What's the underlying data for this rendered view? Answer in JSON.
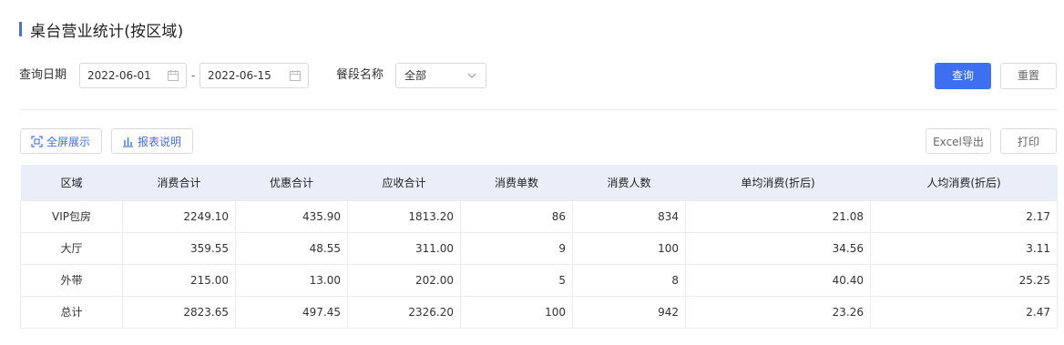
{
  "page": {
    "title": "桌台营业统计(按区域)"
  },
  "filters": {
    "date_label": "查询日期",
    "date_start": "2022-06-01",
    "date_sep": "-",
    "date_end": "2022-06-15",
    "meal_label": "餐段名称",
    "meal_value": "全部",
    "query_button": "查询",
    "reset_button": "重置"
  },
  "toolbar": {
    "fullscreen": "全屏展示",
    "report_desc": "报表说明",
    "excel_export": "Excel导出",
    "print": "打印"
  },
  "colors": {
    "accent": "#3d6ff0",
    "header_bg": "#e9eef9"
  },
  "table": {
    "columns": [
      "区域",
      "消费合计",
      "优惠合计",
      "应收合计",
      "消费单数",
      "消费人数",
      "单均消费(折后)",
      "人均消费(折后)"
    ],
    "rows": [
      [
        "VIP包房",
        "2249.10",
        "435.90",
        "1813.20",
        "86",
        "834",
        "21.08",
        "2.17"
      ],
      [
        "大厅",
        "359.55",
        "48.55",
        "311.00",
        "9",
        "100",
        "34.56",
        "3.11"
      ],
      [
        "外带",
        "215.00",
        "13.00",
        "202.00",
        "5",
        "8",
        "40.40",
        "25.25"
      ],
      [
        "总计",
        "2823.65",
        "497.45",
        "2326.20",
        "100",
        "942",
        "23.26",
        "2.47"
      ]
    ]
  }
}
